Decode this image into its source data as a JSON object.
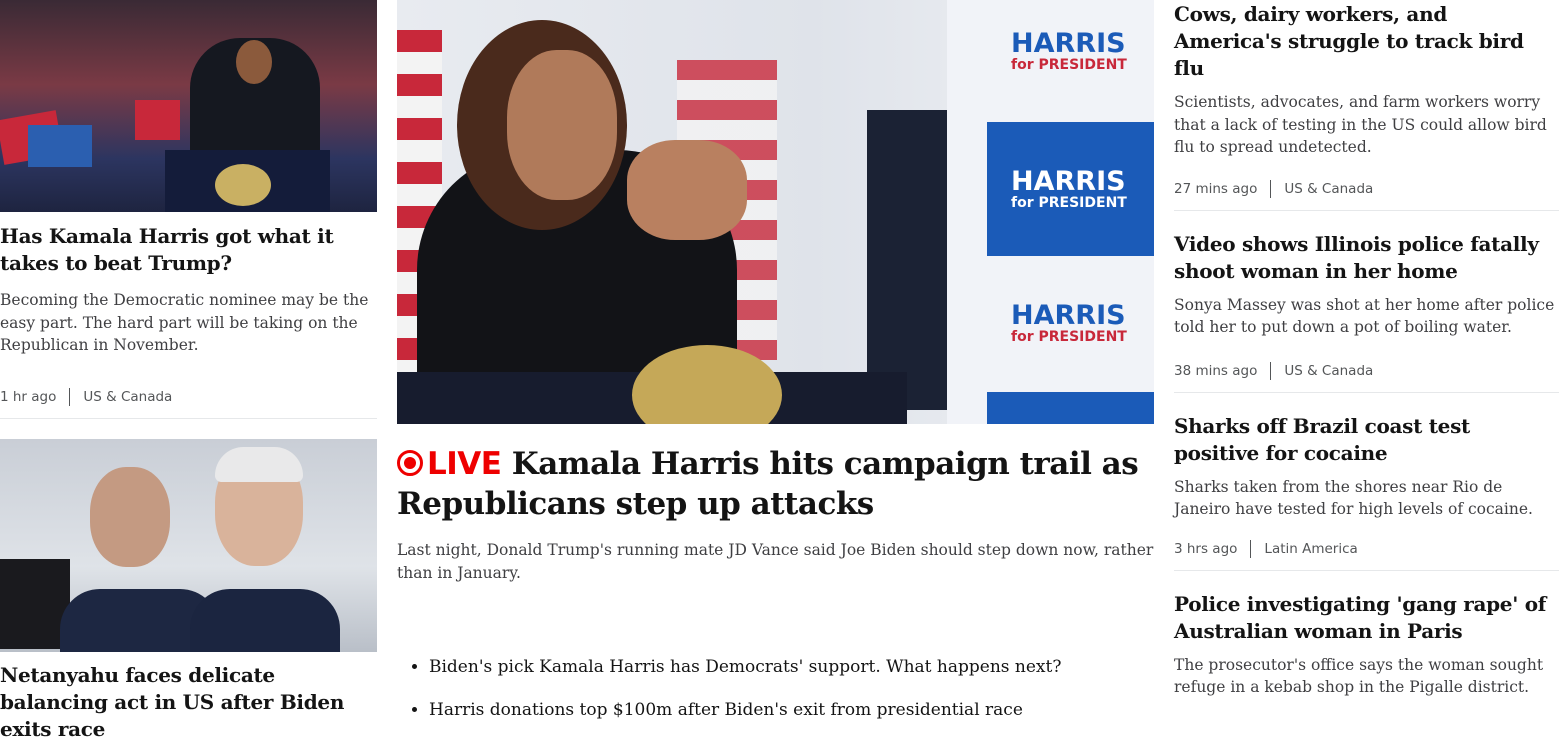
{
  "left": {
    "story1": {
      "title": "Has Kamala Harris got what it takes to beat Trump?",
      "summary": "Becoming the Democratic nominee may be the easy part. The hard part will be taking on the Republican in November.",
      "time": "1 hr ago",
      "section": "US & Canada"
    },
    "story2": {
      "title": "Netanyahu faces delicate balancing act in US after Biden exits race"
    }
  },
  "lead": {
    "live_label": "LIVE",
    "title": "Kamala Harris hits campaign trail as Republicans step up attacks",
    "summary": "Last night, Donald Trump's running mate JD Vance said Joe Biden should step down now, rather than in January.",
    "bullets": [
      "Biden's pick Kamala Harris has Democrats' support. What happens next?",
      "Harris donations top $100m after Biden's exit from presidential race"
    ],
    "image_sign_text": [
      "HARRIS",
      "for PRESIDENT"
    ]
  },
  "right": {
    "stories": [
      {
        "title": "Cows, dairy workers, and America's struggle to track bird flu",
        "summary": "Scientists, advocates, and farm workers worry that a lack of testing in the US could allow bird flu to spread undetected.",
        "time": "27 mins ago",
        "section": "US & Canada"
      },
      {
        "title": "Video shows Illinois police fatally shoot woman in her home",
        "summary": "Sonya Massey was shot at her home after police told her to put down a pot of boiling water.",
        "time": "38 mins ago",
        "section": "US & Canada"
      },
      {
        "title": "Sharks off Brazil coast test positive for cocaine",
        "summary": "Sharks taken from the shores near Rio de Janeiro have tested for high levels of cocaine.",
        "time": "3 hrs ago",
        "section": "Latin America"
      },
      {
        "title": "Police investigating 'gang rape' of Australian woman in Paris",
        "summary": "The prosecutor's office says the woman sought refuge in a kebab shop in the Pigalle district."
      }
    ]
  },
  "colors": {
    "live": "#ee0000",
    "text": "#141414",
    "meta": "#545658",
    "divider": "#e6e8ea"
  }
}
